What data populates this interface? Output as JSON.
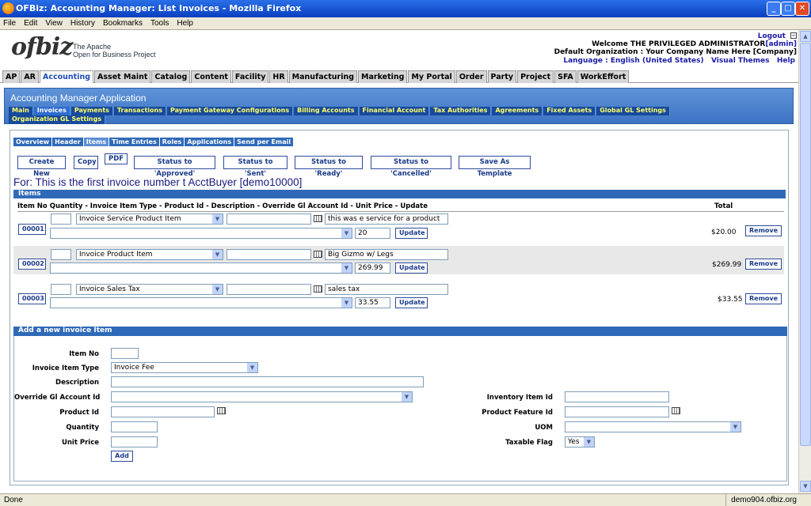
{
  "window": {
    "title": "OFBiz: Accounting Manager: List Invoices - Mozilla Firefox"
  },
  "menu": [
    "File",
    "Edit",
    "View",
    "History",
    "Bookmarks",
    "Tools",
    "Help"
  ],
  "logo": {
    "mark": "ofbiz",
    "line1": "The Apache",
    "line2": "Open for Business Project"
  },
  "header": {
    "logout": "Logout",
    "welcome": "Welcome THE PRIVILEGED ADMINISTRATOR",
    "welcome_user": "[admin]",
    "org": "Default Organization : Your Company Name Here [Company]",
    "language": "Language : English (United States)",
    "themes": "Visual Themes",
    "help": "Help"
  },
  "apptabs": [
    "AP",
    "AR",
    "Accounting",
    "Asset Maint",
    "Catalog",
    "Content",
    "Facility",
    "HR",
    "Manufacturing",
    "Marketing",
    "My Portal",
    "Order",
    "Party",
    "Project",
    "SFA",
    "WorkEffort"
  ],
  "app": {
    "title": "Accounting Manager Application",
    "tabs_row1": [
      "Main",
      "Invoices",
      "Payments",
      "Transactions",
      "Payment Gateway Configurations",
      "Billing Accounts",
      "Financial Account",
      "Tax Authorities",
      "Agreements",
      "Fixed Assets",
      "Global GL Settings"
    ],
    "tabs_row2": [
      "Organization GL Settings"
    ]
  },
  "invoice_tabs": [
    "Overview",
    "Header",
    "Items",
    "Time Entries",
    "Roles",
    "Applications",
    "Send per Email"
  ],
  "actions": [
    "Create New",
    "Copy",
    "PDF",
    "Status to 'Approved'",
    "Status to 'Sent'",
    "Status to 'Ready'",
    "Status to 'Cancelled'",
    "Save As Template"
  ],
  "for_title": "For: This is the first invoice number t AcctBuyer [demo10000]",
  "items": {
    "heading": "Items",
    "columns": "Item No Quantity - Invoice Item Type - Product Id - Description - Override Gl Account Id - Unit Price - Update",
    "total_col": "Total",
    "rows": [
      {
        "no": "00001",
        "type": "Invoice Service Product Item",
        "desc": "this was e service for a product",
        "price": "20",
        "total": "$20.00"
      },
      {
        "no": "00002",
        "type": "Invoice Product Item",
        "desc": "Big Gizmo w/ Legs",
        "price": "269.99",
        "total": "$269.99"
      },
      {
        "no": "00003",
        "type": "Invoice Sales Tax",
        "desc": "sales tax",
        "price": "33.55",
        "total": "$33.55"
      }
    ],
    "update_label": "Update",
    "remove_label": "Remove"
  },
  "add_item": {
    "heading": "Add a new invoice Item",
    "item_no": "Item No",
    "item_type": "Invoice Item Type",
    "item_type_value": "Invoice Fee",
    "description": "Description",
    "override_gl": "Override Gl Account Id",
    "product_id": "Product Id",
    "quantity": "Quantity",
    "unit_price": "Unit Price",
    "inventory_item": "Inventory Item Id",
    "product_feature": "Product Feature Id",
    "uom": "UOM",
    "taxable": "Taxable Flag",
    "taxable_value": "Yes",
    "add_button": "Add"
  },
  "status": {
    "left": "Done",
    "right": "demo904.ofbiz.org"
  }
}
